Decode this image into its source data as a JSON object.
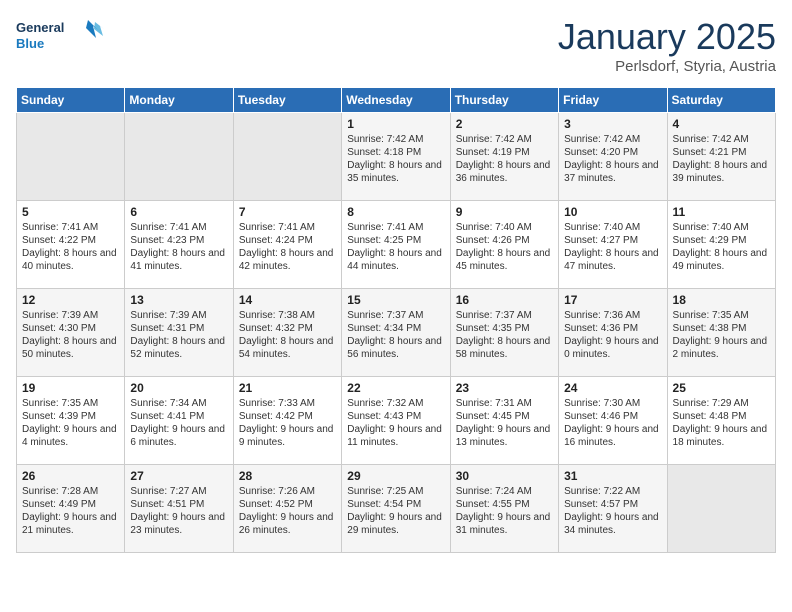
{
  "header": {
    "logo_line1": "General",
    "logo_line2": "Blue",
    "month_title": "January 2025",
    "location": "Perlsdorf, Styria, Austria"
  },
  "weekdays": [
    "Sunday",
    "Monday",
    "Tuesday",
    "Wednesday",
    "Thursday",
    "Friday",
    "Saturday"
  ],
  "weeks": [
    [
      {
        "day": "",
        "text": ""
      },
      {
        "day": "",
        "text": ""
      },
      {
        "day": "",
        "text": ""
      },
      {
        "day": "1",
        "text": "Sunrise: 7:42 AM\nSunset: 4:18 PM\nDaylight: 8 hours and 35 minutes."
      },
      {
        "day": "2",
        "text": "Sunrise: 7:42 AM\nSunset: 4:19 PM\nDaylight: 8 hours and 36 minutes."
      },
      {
        "day": "3",
        "text": "Sunrise: 7:42 AM\nSunset: 4:20 PM\nDaylight: 8 hours and 37 minutes."
      },
      {
        "day": "4",
        "text": "Sunrise: 7:42 AM\nSunset: 4:21 PM\nDaylight: 8 hours and 39 minutes."
      }
    ],
    [
      {
        "day": "5",
        "text": "Sunrise: 7:41 AM\nSunset: 4:22 PM\nDaylight: 8 hours and 40 minutes."
      },
      {
        "day": "6",
        "text": "Sunrise: 7:41 AM\nSunset: 4:23 PM\nDaylight: 8 hours and 41 minutes."
      },
      {
        "day": "7",
        "text": "Sunrise: 7:41 AM\nSunset: 4:24 PM\nDaylight: 8 hours and 42 minutes."
      },
      {
        "day": "8",
        "text": "Sunrise: 7:41 AM\nSunset: 4:25 PM\nDaylight: 8 hours and 44 minutes."
      },
      {
        "day": "9",
        "text": "Sunrise: 7:40 AM\nSunset: 4:26 PM\nDaylight: 8 hours and 45 minutes."
      },
      {
        "day": "10",
        "text": "Sunrise: 7:40 AM\nSunset: 4:27 PM\nDaylight: 8 hours and 47 minutes."
      },
      {
        "day": "11",
        "text": "Sunrise: 7:40 AM\nSunset: 4:29 PM\nDaylight: 8 hours and 49 minutes."
      }
    ],
    [
      {
        "day": "12",
        "text": "Sunrise: 7:39 AM\nSunset: 4:30 PM\nDaylight: 8 hours and 50 minutes."
      },
      {
        "day": "13",
        "text": "Sunrise: 7:39 AM\nSunset: 4:31 PM\nDaylight: 8 hours and 52 minutes."
      },
      {
        "day": "14",
        "text": "Sunrise: 7:38 AM\nSunset: 4:32 PM\nDaylight: 8 hours and 54 minutes."
      },
      {
        "day": "15",
        "text": "Sunrise: 7:37 AM\nSunset: 4:34 PM\nDaylight: 8 hours and 56 minutes."
      },
      {
        "day": "16",
        "text": "Sunrise: 7:37 AM\nSunset: 4:35 PM\nDaylight: 8 hours and 58 minutes."
      },
      {
        "day": "17",
        "text": "Sunrise: 7:36 AM\nSunset: 4:36 PM\nDaylight: 9 hours and 0 minutes."
      },
      {
        "day": "18",
        "text": "Sunrise: 7:35 AM\nSunset: 4:38 PM\nDaylight: 9 hours and 2 minutes."
      }
    ],
    [
      {
        "day": "19",
        "text": "Sunrise: 7:35 AM\nSunset: 4:39 PM\nDaylight: 9 hours and 4 minutes."
      },
      {
        "day": "20",
        "text": "Sunrise: 7:34 AM\nSunset: 4:41 PM\nDaylight: 9 hours and 6 minutes."
      },
      {
        "day": "21",
        "text": "Sunrise: 7:33 AM\nSunset: 4:42 PM\nDaylight: 9 hours and 9 minutes."
      },
      {
        "day": "22",
        "text": "Sunrise: 7:32 AM\nSunset: 4:43 PM\nDaylight: 9 hours and 11 minutes."
      },
      {
        "day": "23",
        "text": "Sunrise: 7:31 AM\nSunset: 4:45 PM\nDaylight: 9 hours and 13 minutes."
      },
      {
        "day": "24",
        "text": "Sunrise: 7:30 AM\nSunset: 4:46 PM\nDaylight: 9 hours and 16 minutes."
      },
      {
        "day": "25",
        "text": "Sunrise: 7:29 AM\nSunset: 4:48 PM\nDaylight: 9 hours and 18 minutes."
      }
    ],
    [
      {
        "day": "26",
        "text": "Sunrise: 7:28 AM\nSunset: 4:49 PM\nDaylight: 9 hours and 21 minutes."
      },
      {
        "day": "27",
        "text": "Sunrise: 7:27 AM\nSunset: 4:51 PM\nDaylight: 9 hours and 23 minutes."
      },
      {
        "day": "28",
        "text": "Sunrise: 7:26 AM\nSunset: 4:52 PM\nDaylight: 9 hours and 26 minutes."
      },
      {
        "day": "29",
        "text": "Sunrise: 7:25 AM\nSunset: 4:54 PM\nDaylight: 9 hours and 29 minutes."
      },
      {
        "day": "30",
        "text": "Sunrise: 7:24 AM\nSunset: 4:55 PM\nDaylight: 9 hours and 31 minutes."
      },
      {
        "day": "31",
        "text": "Sunrise: 7:22 AM\nSunset: 4:57 PM\nDaylight: 9 hours and 34 minutes."
      },
      {
        "day": "",
        "text": ""
      }
    ]
  ]
}
